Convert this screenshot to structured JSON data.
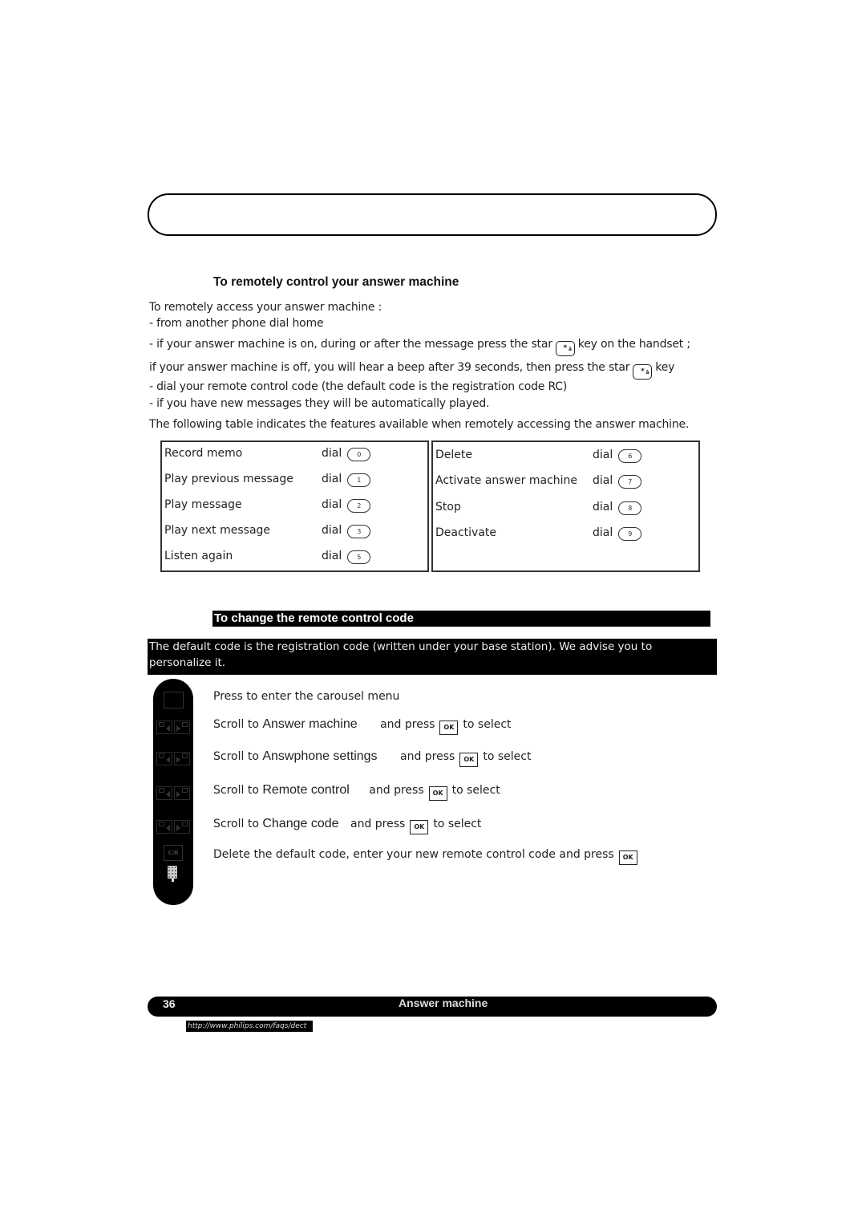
{
  "header": {
    "title": ""
  },
  "section1": {
    "title": "To remotely control your answer machine",
    "lines": [
      "To remotely access your answer machine :",
      "- from another phone dial home"
    ],
    "line_on_prefix": "- if your answer machine is on, during or after the message press the star",
    "line_on_suffix": "key on the handset ;",
    "line_off_prefix": "if your answer machine is off, you will hear a beep after 39 seconds, then press the star",
    "line_off_suffix": "key",
    "lines_after": [
      "- dial your remote control code (the default code is the registration code RC)",
      "- if you have new messages they will be automatically played."
    ],
    "table_intro": "The following table indicates the features available when remotely accessing the answer machine.",
    "star_key": {
      "icon": "star-key-icon",
      "main": "*",
      "sub": "â",
      "corner": "E"
    }
  },
  "tables": {
    "dial_label": "dial",
    "left": [
      {
        "feature": "Record memo",
        "key": "0"
      },
      {
        "feature": "Play previous message",
        "key": "1"
      },
      {
        "feature": "Play message",
        "key": "2"
      },
      {
        "feature": "Play next message",
        "key": "3"
      },
      {
        "feature": "Listen again",
        "key": "5"
      }
    ],
    "right": [
      {
        "feature": "Delete",
        "key": "6"
      },
      {
        "feature": "Activate answer machine",
        "key": "7"
      },
      {
        "feature": "Stop",
        "key": "8"
      },
      {
        "feature": "Deactivate",
        "key": "9"
      }
    ]
  },
  "section2": {
    "title": "To change the remote control code",
    "note": "The default code is the registration code (written under your base station). We advise you to personalize it.",
    "ok_label": "OK",
    "steps": [
      {
        "text": "Press to enter the carousel menu"
      },
      {
        "prefix": "Scroll to",
        "menu": "Answer machine",
        "and_press": "and press",
        "suffix": "to select"
      },
      {
        "prefix": "Scroll to",
        "menu": "Answphone settings",
        "and_press": "and press",
        "suffix": "to select"
      },
      {
        "prefix": "Scroll to",
        "menu": "Remote control",
        "and_press": "and press",
        "suffix": "to select"
      },
      {
        "prefix": "Scroll to",
        "menu": "Change code",
        "and_press": "and press",
        "suffix": "to select"
      },
      {
        "text": "Delete the default code, enter your new remote control code and press"
      }
    ],
    "phone_icons": {
      "cr_label": "C/R"
    }
  },
  "footer": {
    "page_number": "36",
    "title": "Answer machine",
    "url": "http://www.philips.com/faqs/dect"
  }
}
